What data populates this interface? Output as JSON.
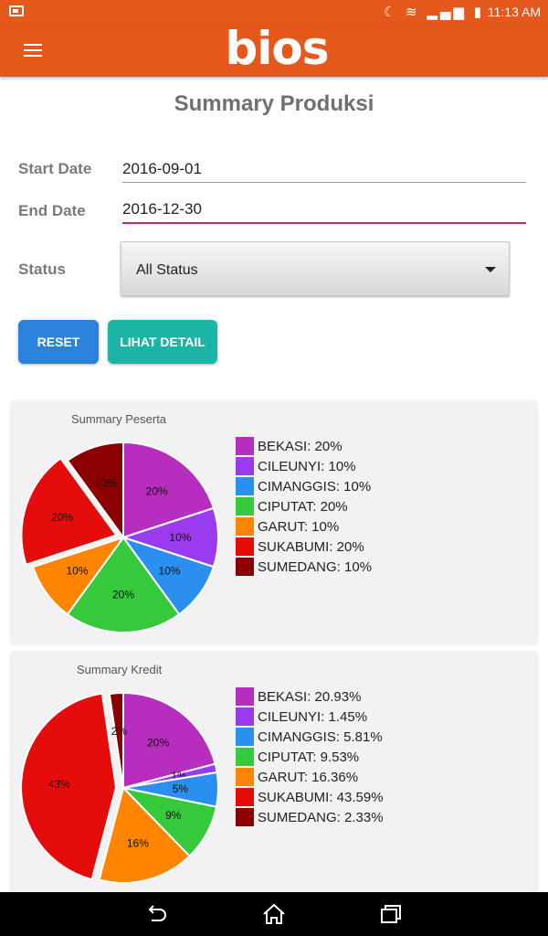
{
  "statusbar": {
    "time": "11:13 AM",
    "icons": "☾ ≋ ▂▄▆ ▮"
  },
  "appbar": {
    "logo": "bios",
    "menu_icon": "hamburger-icon"
  },
  "page": {
    "title": "Summary Produksi"
  },
  "form": {
    "start_label": "Start Date",
    "start_value": "2016-09-01",
    "end_label": "End Date",
    "end_value": "2016-12-30",
    "status_label": "Status",
    "status_value": "All Status"
  },
  "buttons": {
    "reset": "RESET",
    "detail": "LIHAT DETAIL"
  },
  "colors": {
    "accent": "#e5581c",
    "slices": [
      "#b72dbd",
      "#9b3bf0",
      "#2b8ff0",
      "#36c93c",
      "#ff8400",
      "#e50c0c",
      "#8b0000"
    ]
  },
  "chart_data": [
    {
      "type": "pie",
      "title": "Summary Peserta",
      "categories": [
        "BEKASI",
        "CILEUNYI",
        "CIMANGGIS",
        "CIPUTAT",
        "GARUT",
        "SUKABUMI",
        "SUMEDANG"
      ],
      "values": [
        20,
        10,
        10,
        20,
        10,
        20,
        10
      ],
      "slice_labels": [
        "20%",
        "10%",
        "10%",
        "20%",
        "10%",
        "20%",
        "10%"
      ],
      "legend": [
        "BEKASI: 20%",
        "CILEUNYI: 10%",
        "CIMANGGIS: 10%",
        "CIPUTAT: 20%",
        "GARUT: 10%",
        "SUKABUMI: 20%",
        "SUMEDANG: 10%"
      ],
      "exploded_index": 5,
      "legend_position": "right"
    },
    {
      "type": "pie",
      "title": "Summary Kredit",
      "categories": [
        "BEKASI",
        "CILEUNYI",
        "CIMANGGIS",
        "CIPUTAT",
        "GARUT",
        "SUKABUMI",
        "SUMEDANG"
      ],
      "values": [
        20.93,
        1.45,
        5.81,
        9.53,
        16.36,
        43.59,
        2.33
      ],
      "slice_labels": [
        "20%",
        "1%",
        "5%",
        "9%",
        "16%",
        "43%",
        "2%"
      ],
      "legend": [
        "BEKASI: 20.93%",
        "CILEUNYI: 1.45%",
        "CIMANGGIS: 5.81%",
        "CIPUTAT: 9.53%",
        "GARUT: 16.36%",
        "SUKABUMI: 43.59%",
        "SUMEDANG: 2.33%"
      ],
      "exploded_index": 5,
      "legend_position": "right"
    }
  ],
  "navbar": {
    "icons": [
      "back-icon",
      "home-icon",
      "recents-icon"
    ]
  }
}
